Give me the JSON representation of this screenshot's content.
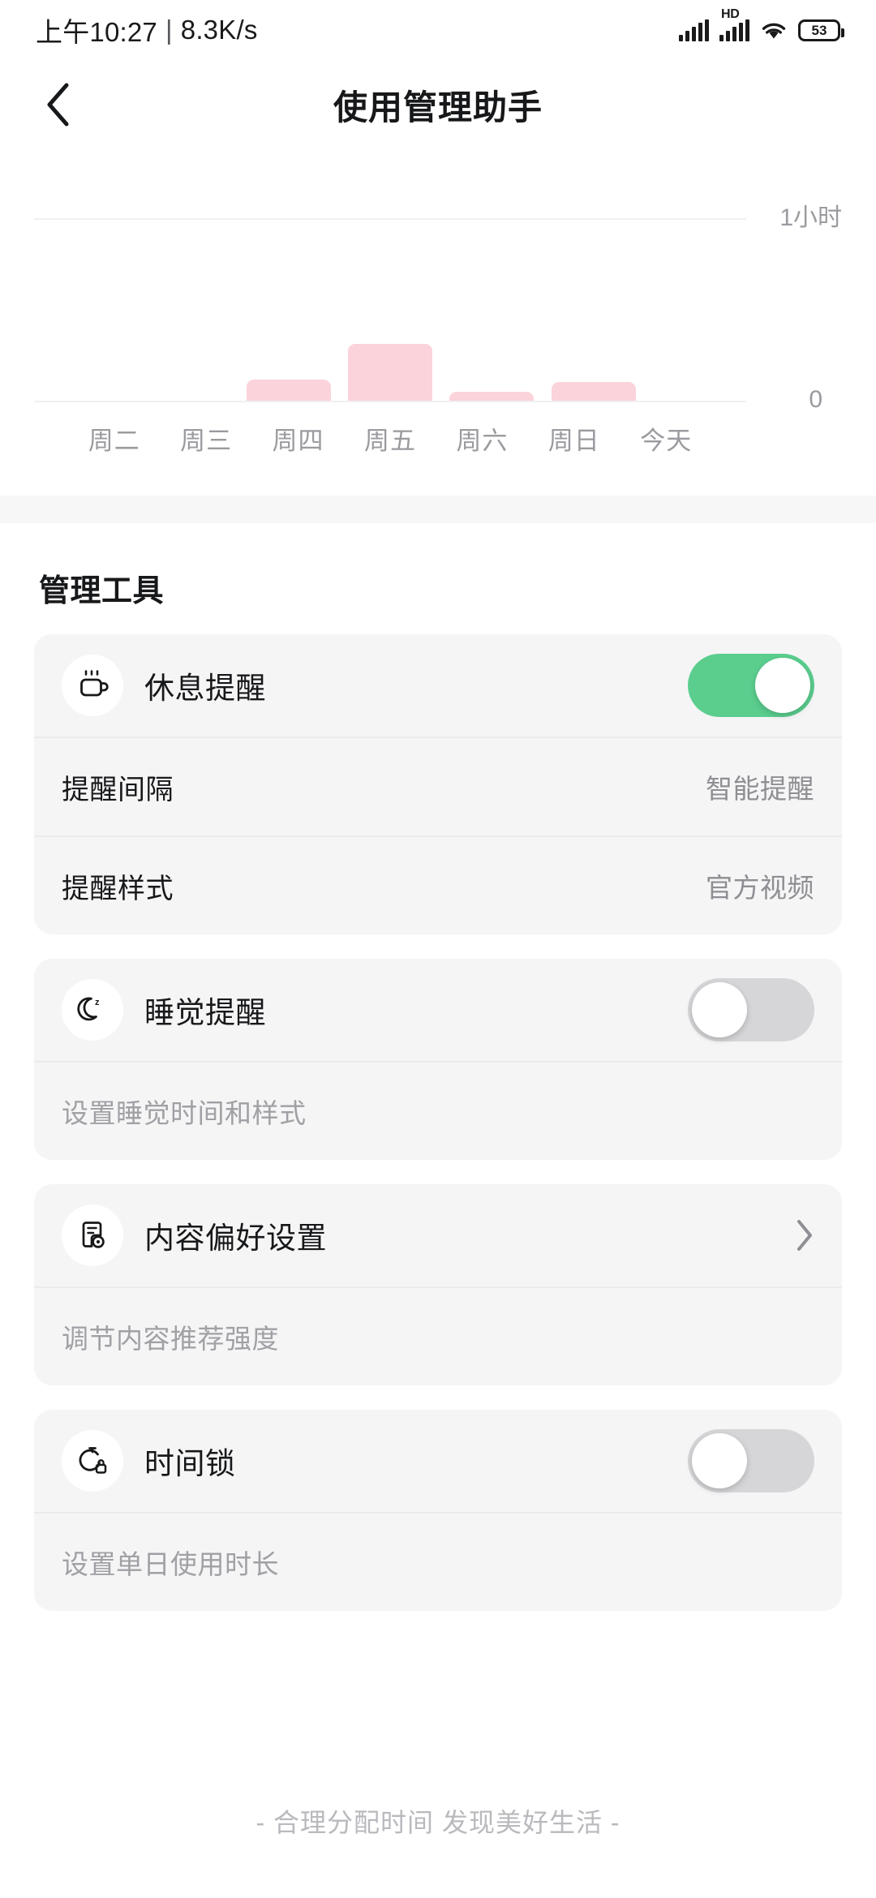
{
  "status_bar": {
    "time": "上午10:27",
    "separator": "|",
    "net_speed": "8.3K/s",
    "hd_label": "HD",
    "battery_level": "53",
    "icons": [
      "signal-bars-icon",
      "signal-bars-hd-icon",
      "wifi-icon",
      "battery-icon"
    ]
  },
  "nav": {
    "back_icon": "chevron-left-icon",
    "title": "使用管理助手"
  },
  "chart_data": {
    "type": "bar",
    "title": "",
    "categories": [
      "周二",
      "周三",
      "周四",
      "周五",
      "周六",
      "周日",
      "今天"
    ],
    "values": [
      0,
      0,
      0.12,
      0.33,
      0.05,
      0.11,
      0
    ],
    "value_unit": "小时",
    "ylim": [
      0,
      1.2
    ],
    "yticks": [
      0,
      1
    ],
    "ytick_labels": [
      "0",
      "1小时"
    ],
    "bar_color": "#FBD3DA",
    "grid": true,
    "legend": "none",
    "xlabel": "",
    "ylabel": ""
  },
  "section": {
    "title": "管理工具"
  },
  "cards": [
    {
      "id": "break-reminder",
      "icon": "coffee-cup-icon",
      "label": "休息提醒",
      "toggle": "on",
      "sub_rows": [
        {
          "id": "reminder-interval",
          "label": "提醒间隔",
          "value": "智能提醒"
        },
        {
          "id": "reminder-style",
          "label": "提醒样式",
          "value": "官方视频"
        }
      ]
    },
    {
      "id": "sleep-reminder",
      "icon": "moon-sleep-icon",
      "label": "睡觉提醒",
      "toggle": "off",
      "note": "设置睡觉时间和样式"
    },
    {
      "id": "content-preference",
      "icon": "document-settings-icon",
      "label": "内容偏好设置",
      "chevron": "chevron-right-icon",
      "note": "调节内容推荐强度"
    },
    {
      "id": "time-lock",
      "icon": "stopwatch-lock-icon",
      "label": "时间锁",
      "toggle": "off",
      "note": "设置单日使用时长"
    }
  ],
  "footer": {
    "text": "- 合理分配时间 发现美好生活 -"
  },
  "colors": {
    "accent_green": "#5BCE8E",
    "bar_pink": "#FBD3DA",
    "card_bg": "#F5F5F6",
    "toggle_off": "#D6D6D9",
    "text_primary": "#17181A",
    "text_secondary": "#8E8E93"
  }
}
